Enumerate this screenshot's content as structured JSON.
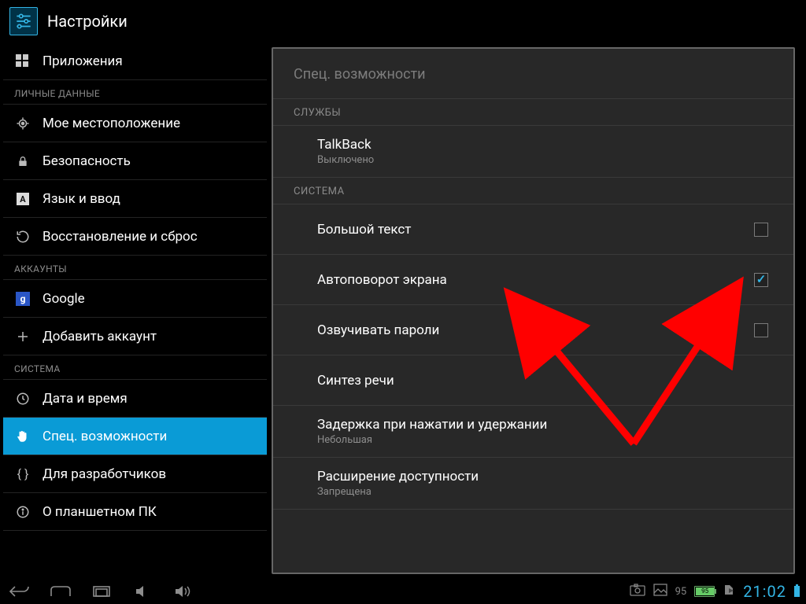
{
  "header": {
    "title": "Настройки"
  },
  "sidebar": {
    "top_item": {
      "label": "Приложения"
    },
    "cat_personal": "ЛИЧНЫЕ ДАННЫЕ",
    "items_personal": [
      {
        "label": "Мое местоположение"
      },
      {
        "label": "Безопасность"
      },
      {
        "label": "Язык и ввод"
      },
      {
        "label": "Восстановление и сброс"
      }
    ],
    "cat_accounts": "АККАУНТЫ",
    "items_accounts": [
      {
        "label": "Google"
      },
      {
        "label": "Добавить аккаунт"
      }
    ],
    "cat_system": "СИСТЕМА",
    "items_system": [
      {
        "label": "Дата и время"
      },
      {
        "label": "Спец. возможности"
      },
      {
        "label": "Для разработчиков"
      },
      {
        "label": "О планшетном ПК"
      }
    ]
  },
  "panel": {
    "title": "Спец. возможности",
    "section_services": "СЛУЖБЫ",
    "talkback": {
      "title": "TalkBack",
      "sub": "Выключено"
    },
    "section_system": "СИСТЕМА",
    "big_text": {
      "title": "Большой текст",
      "checked": false
    },
    "autorotate": {
      "title": "Автоповорот экрана",
      "checked": true
    },
    "speak_pw": {
      "title": "Озвучивать пароли",
      "checked": false
    },
    "tts": {
      "title": "Синтез речи"
    },
    "delay": {
      "title": "Задержка при нажатии и удержании",
      "sub": "Небольшая"
    },
    "enhance": {
      "title": "Расширение доступности",
      "sub": "Запрещена"
    }
  },
  "navbar": {
    "battery_pct": "95",
    "battery_inner": "95",
    "time": "21:02"
  }
}
